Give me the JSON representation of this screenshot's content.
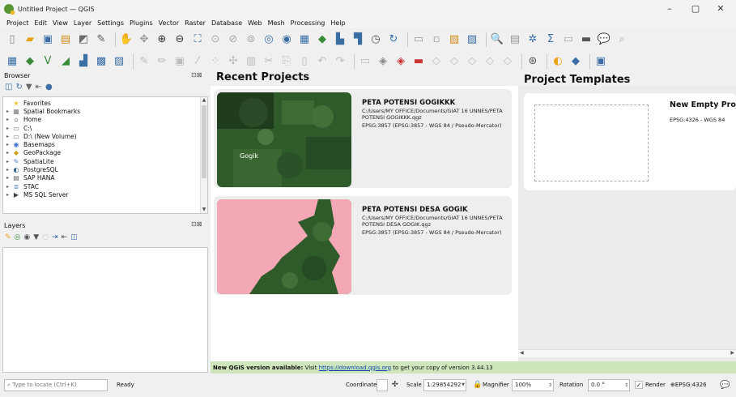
{
  "window": {
    "title": "Untitled Project — QGIS",
    "controls": [
      "–",
      "▢",
      "✕"
    ]
  },
  "menubar": {
    "items": [
      "Project",
      "Edit",
      "View",
      "Layer",
      "Settings",
      "Plugins",
      "Vector",
      "Raster",
      "Database",
      "Web",
      "Mesh",
      "Processing",
      "Help"
    ]
  },
  "icons": {
    "toolbar1": [
      "new-project-icon",
      "open-project-icon",
      "save-project-icon",
      "print-layout-icon",
      "style-manager-icon",
      "pan-icon",
      "pan-to-selection-icon",
      "zoom-in-icon",
      "zoom-out-icon",
      "zoom-full-icon",
      "identify-icon",
      "refresh-icon",
      "measure-icon",
      "attribute-table-icon",
      "sum-icon",
      "python-icon"
    ],
    "toolbar2": [
      "open-data-source-icon",
      "add-vector-icon",
      "add-raster-icon",
      "add-postgis-icon",
      "add-wms-icon",
      "digitize-icon",
      "node-tool-icon",
      "python-plugin-icon",
      "help-icon"
    ]
  },
  "browser": {
    "title": "Browser",
    "items": [
      {
        "label": "Favorites",
        "icon": "★",
        "color": "#f2c12e"
      },
      {
        "label": "Spatial Bookmarks",
        "icon": "▦",
        "color": "#777777"
      },
      {
        "label": "Home",
        "icon": "⌂",
        "color": "#777777"
      },
      {
        "label": "C:\\",
        "icon": "▭",
        "color": "#777777"
      },
      {
        "label": "D:\\ (New Volume)",
        "icon": "▭",
        "color": "#777777"
      },
      {
        "label": "Basemaps",
        "icon": "◉",
        "color": "#3b6fd1"
      },
      {
        "label": "GeoPackage",
        "icon": "◆",
        "color": "#c9a21a"
      },
      {
        "label": "SpatiaLite",
        "icon": "✎",
        "color": "#4a7fc1"
      },
      {
        "label": "PostgreSQL",
        "icon": "◐",
        "color": "#336791"
      },
      {
        "label": "SAP HANA",
        "icon": "▤",
        "color": "#666666"
      },
      {
        "label": "STAC",
        "icon": "≣",
        "color": "#5a8ec7"
      },
      {
        "label": "MS SQL Server",
        "icon": "▶",
        "color": "#444444"
      }
    ]
  },
  "layers": {
    "title": "Layers"
  },
  "panel_controls": "⊡⊠",
  "welcome": {
    "recent_title": "Recent Projects",
    "templates_title": "Project Templates",
    "projects": [
      {
        "name": "PETA POTENSI GOGIKKK",
        "path": "C:/Users/MY OFFICE/Documents/GIAT 16 UNNES/PETA POTENSI GOGIKKK.qgz",
        "crs": "EPSG:3857 (EPSG:3857 - WGS 84 / Pseudo-Mercator)",
        "thumb_label": "Gogik"
      },
      {
        "name": "PETA POTENSI DESA GOGIK",
        "path": "C:/Users/MY OFFICE/Documents/GIAT 16 UNNES/PETA POTENSI DESA GOGIK.qgz",
        "crs": "EPSG:3857 (EPSG:3857 - WGS 84 / Pseudo-Mercator)"
      }
    ],
    "template": {
      "name": "New Empty Proje",
      "crs": "EPSG:4326 - WGS 84"
    }
  },
  "notification": {
    "bold": "New QGIS version available:",
    "before": " Visit ",
    "link": "https://download.qgis.org",
    "after": " to get your copy of version 3.44.13"
  },
  "statusbar": {
    "locate_placeholder": "Type to locate (Ctrl+K)",
    "ready": "Ready",
    "coordinate_label": "Coordinate",
    "coordinate_value": "",
    "scale_label": "Scale",
    "scale_value": "1:29854292",
    "magnifier_label": "Magnifier",
    "magnifier_value": "100%",
    "rotation_label": "Rotation",
    "rotation_value": "0.0 °",
    "render_label": "Render",
    "crs": "EPSG:4326"
  },
  "colors": {
    "qgis_green": "#589632",
    "notification_bg": "#cfe6bd",
    "link": "#0645ad",
    "pink_polygon": "#f4a7b5",
    "forest": "#2f5a2a"
  }
}
